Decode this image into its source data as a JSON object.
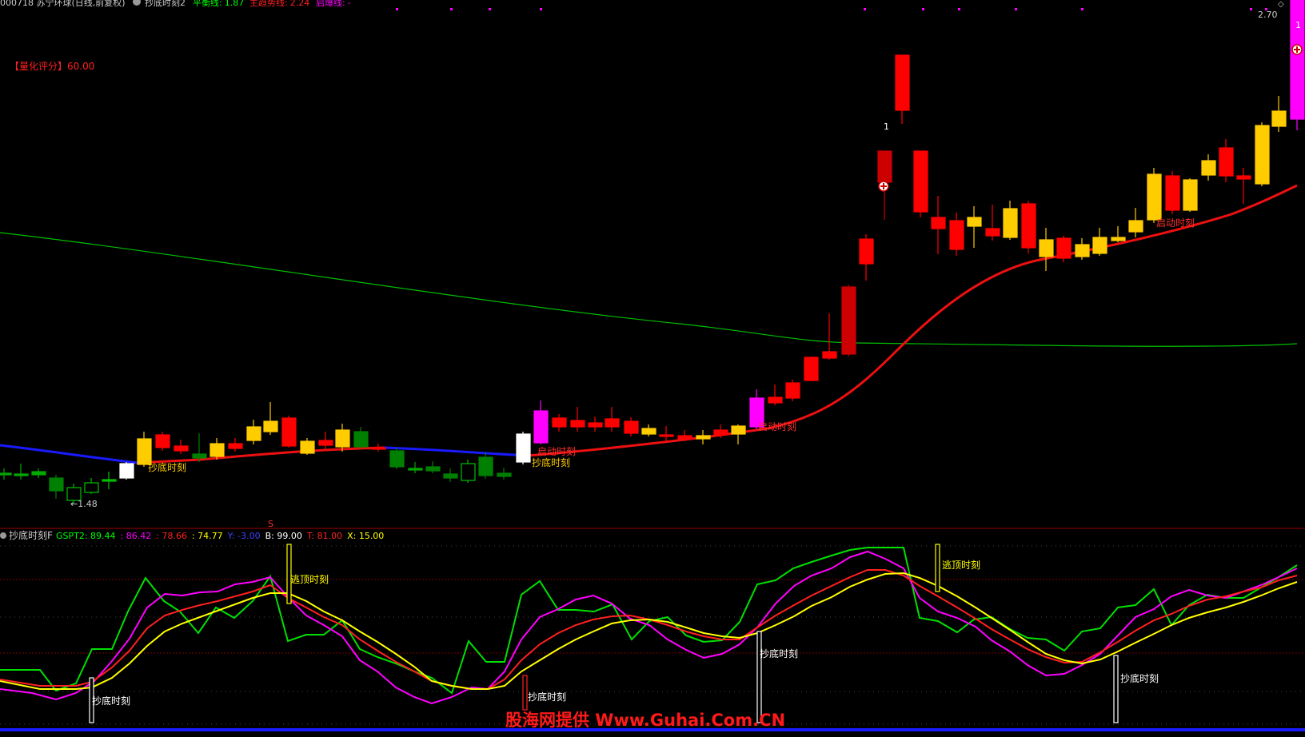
{
  "header": {
    "stock": "000718 苏宁环球(日线,前复权)",
    "indicator_name": "抄底时刻2",
    "items": [
      {
        "label": "平衡线:",
        "value": "1.87",
        "color": "#00ff00"
      },
      {
        "label": "主趋势线:",
        "value": "2.24",
        "color": "#ff2020"
      },
      {
        "label": "启爆线:",
        "value": "-",
        "color": "#ff00ff"
      }
    ]
  },
  "main": {
    "score_label": "【量化评分】",
    "score_value": "60.00",
    "price_top": "2.70",
    "low_label": "1.48",
    "high_marker": "1",
    "right_marker": "1",
    "signals": [
      "抄底时刻",
      "启动时刻",
      "抄底时刻",
      "启动时刻",
      "启动时刻"
    ]
  },
  "sub": {
    "name": "抄底时刻F",
    "items": [
      {
        "label": "GSPT2:",
        "value": "89.44",
        "color": "#00ff00"
      },
      {
        "label": "",
        "value": "86.42",
        "color": "#ff00ff"
      },
      {
        "label": "",
        "value": "78.66",
        "color": "#ff2020"
      },
      {
        "label": "",
        "value": "74.77",
        "color": "#ffff00"
      },
      {
        "label": "Y:",
        "value": "-3.00",
        "color": "#4040ff"
      },
      {
        "label": "B:",
        "value": "99.00",
        "color": "#ffffff"
      },
      {
        "label": "T:",
        "value": "81.00",
        "color": "#ff2020"
      },
      {
        "label": "X:",
        "value": "15.00",
        "color": "#ffff00"
      }
    ],
    "signals": [
      "抄底时刻",
      "逃顶时刻",
      "抄底时刻",
      "抄底时刻",
      "逃顶时刻",
      "抄底时刻"
    ],
    "marker_s": "S"
  },
  "watermark": "股海网提供 Www.Guhai.Com.CN"
}
